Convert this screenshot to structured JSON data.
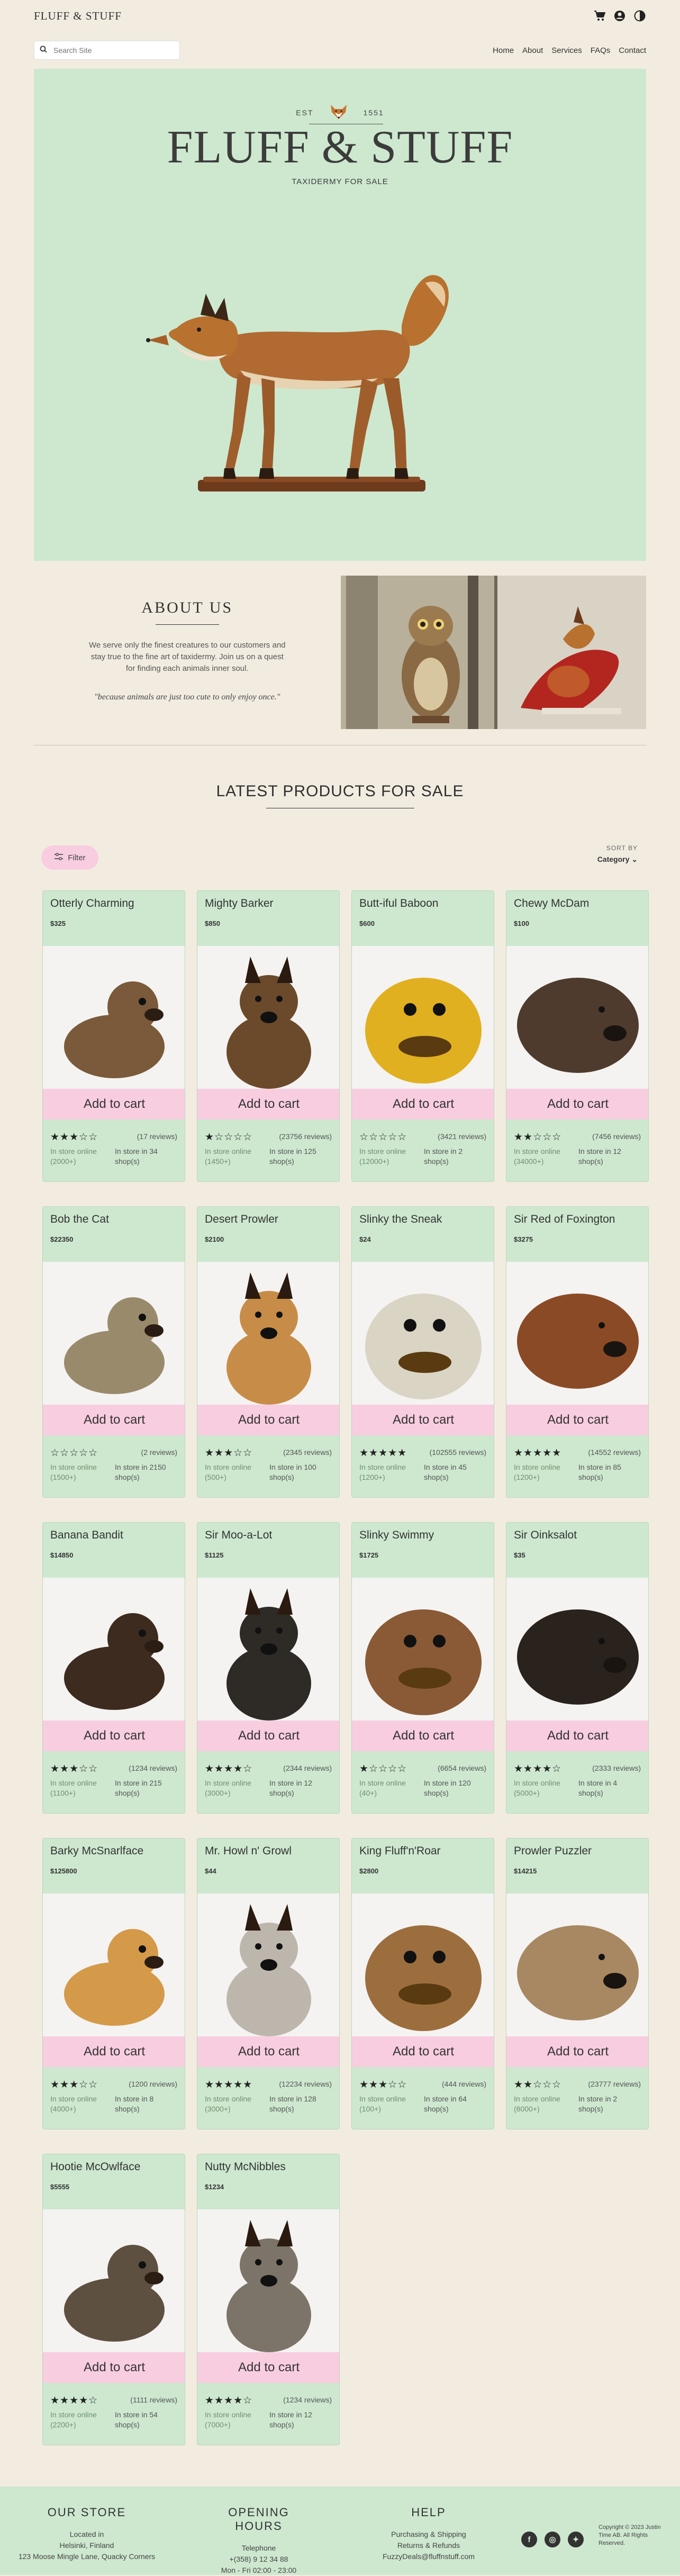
{
  "header": {
    "logo": "FLUFF & STUFF",
    "icons": [
      "cart-icon",
      "account-icon",
      "theme-toggle-icon"
    ]
  },
  "nav": {
    "search_placeholder": "Search Site",
    "links": [
      "Home",
      "About",
      "Services",
      "FAQs",
      "Contact"
    ]
  },
  "hero": {
    "est_left": "EST",
    "est_right": "1551",
    "title": "FLUFF & STUFF",
    "subtitle": "TAXIDERMY FOR SALE"
  },
  "about": {
    "title": "ABOUT US",
    "body": "We serve only the finest creatures to our customers and stay true to the fine art of taxidermy. Join us on a quest for finding each animals inner soul.",
    "quote": "\"because animals are just too cute to only enjoy once.\""
  },
  "products_section": {
    "title": "LATEST PRODUCTS FOR SALE",
    "filter_label": "Filter",
    "sort_label": "SORT BY",
    "sort_value": "Category"
  },
  "cart_label": "Add to cart",
  "products": [
    {
      "name": "Otterly Charming",
      "price": "$325",
      "stars": "★★★☆☆",
      "rating": 3,
      "reviews": "(17 reviews)",
      "online": "In store online (2000+)",
      "store": "In store in 34 shop(s)",
      "color": "#7a5a3a"
    },
    {
      "name": "Mighty Barker",
      "price": "$850",
      "stars": "★☆☆☆☆",
      "rating": 1,
      "reviews": "(23756 reviews)",
      "online": "In store online (1450+)",
      "store": "In store in 125 shop(s)",
      "color": "#6b4a2b"
    },
    {
      "name": "Butt-iful Baboon",
      "price": "$600",
      "stars": "☆☆☆☆☆",
      "rating": 0,
      "reviews": "(3421 reviews)",
      "online": "In store online (12000+)",
      "store": "In store in 2 shop(s)",
      "color": "#e0b020"
    },
    {
      "name": "Chewy McDam",
      "price": "$100",
      "stars": "★★☆☆☆",
      "rating": 2,
      "reviews": "(7456 reviews)",
      "online": "In store online (34000+)",
      "store": "In store in 12 shop(s)",
      "color": "#4e3b2e"
    },
    {
      "name": "Bob the Cat",
      "price": "$22350",
      "stars": "☆☆☆☆☆",
      "rating": 0,
      "reviews": "(2 reviews)",
      "online": "In store online (1500+)",
      "store": "In store in 2150 shop(s)",
      "color": "#9a8a6c"
    },
    {
      "name": "Desert Prowler",
      "price": "$2100",
      "stars": "★★★☆☆",
      "rating": 3,
      "reviews": "(2345 reviews)",
      "online": "In store online (500+)",
      "store": "In store in 100 shop(s)",
      "color": "#c78d48"
    },
    {
      "name": "Slinky the Sneak",
      "price": "$24",
      "stars": "★★★★★",
      "rating": 5,
      "reviews": "(102555 reviews)",
      "online": "In store online (1200+)",
      "store": "In store in 45 shop(s)",
      "color": "#d9d4c4"
    },
    {
      "name": "Sir Red of Foxington",
      "price": "$3275",
      "stars": "★★★★★",
      "rating": 5,
      "reviews": "(14552 reviews)",
      "online": "In store online (1200+)",
      "store": "In store in 85 shop(s)",
      "color": "#8b4a26"
    },
    {
      "name": "Banana Bandit",
      "price": "$14850",
      "stars": "★★★☆☆",
      "rating": 3,
      "reviews": "(1234 reviews)",
      "online": "In store online (1100+)",
      "store": "In store in 215 shop(s)",
      "color": "#3d2b1f"
    },
    {
      "name": "Sir Moo-a-Lot",
      "price": "$1125",
      "stars": "★★★★☆",
      "rating": 4,
      "reviews": "(2344 reviews)",
      "online": "In store online (3000+)",
      "store": "In store in 12 shop(s)",
      "color": "#2e2a26"
    },
    {
      "name": "Slinky Swimmy",
      "price": "$1725",
      "stars": "★☆☆☆☆",
      "rating": 1,
      "reviews": "(6654 reviews)",
      "online": "In store online (40+)",
      "store": "In store in 120 shop(s)",
      "color": "#8a5a36"
    },
    {
      "name": "Sir Oinksalot",
      "price": "$35",
      "stars": "★★★★☆",
      "rating": 4,
      "reviews": "(2333 reviews)",
      "online": "In store online (5000+)",
      "store": "In store in 4 shop(s)",
      "color": "#2a221c"
    },
    {
      "name": "Barky McSnarlface",
      "price": "$125800",
      "stars": "★★★☆☆",
      "rating": 3,
      "reviews": "(1200 reviews)",
      "online": "In store online (4000+)",
      "store": "In store in 8 shop(s)",
      "color": "#d49a4a"
    },
    {
      "name": "Mr. Howl n' Growl",
      "price": "$44",
      "stars": "★★★★★",
      "rating": 5,
      "reviews": "(12234 reviews)",
      "online": "In store online (3000+)",
      "store": "In store in 128 shop(s)",
      "color": "#bdb6ad"
    },
    {
      "name": "King Fluff'n'Roar",
      "price": "$2800",
      "stars": "★★★☆☆",
      "rating": 3,
      "reviews": "(444 reviews)",
      "online": "In store online (100+)",
      "store": "In store in 64 shop(s)",
      "color": "#9c6e3e"
    },
    {
      "name": "Prowler Puzzler",
      "price": "$14215",
      "stars": "★★☆☆☆",
      "rating": 2,
      "reviews": "(23777 reviews)",
      "online": "In store online (8000+)",
      "store": "In store in 2 shop(s)",
      "color": "#a88862"
    },
    {
      "name": "Hootie McOwlface",
      "price": "$5555",
      "stars": "★★★★☆",
      "rating": 4,
      "reviews": "(1111 reviews)",
      "online": "In store online (2200+)",
      "store": "In store in 54 shop(s)",
      "color": "#5e5040"
    },
    {
      "name": "Nutty McNibbles",
      "price": "$1234",
      "stars": "★★★★☆",
      "rating": 4,
      "reviews": "(1234 reviews)",
      "online": "In store online (7000+)",
      "store": "In store in 12 shop(s)",
      "color": "#7c7468"
    }
  ],
  "footer": {
    "store_title": "OUR STORE",
    "store_lines": [
      "Located in",
      "Helsinki, Finland",
      "123 Moose Mingle Lane, Quacky Corners"
    ],
    "hours_title": "OPENING HOURS",
    "hours_lines": [
      "Telephone",
      "+(358) 9 12 34 88",
      "Mon - Fri 02:00 - 23:00"
    ],
    "help_title": "HELP",
    "help_lines": [
      "Purchasing & Shipping",
      "Returns & Refunds",
      "FuzzyDeals@fluffnstuff.com"
    ],
    "social": [
      "facebook-icon",
      "instagram-icon",
      "twitter-icon"
    ],
    "copyright": "Copyright © 2023 Justin Time AB. All Rights Reserved."
  }
}
